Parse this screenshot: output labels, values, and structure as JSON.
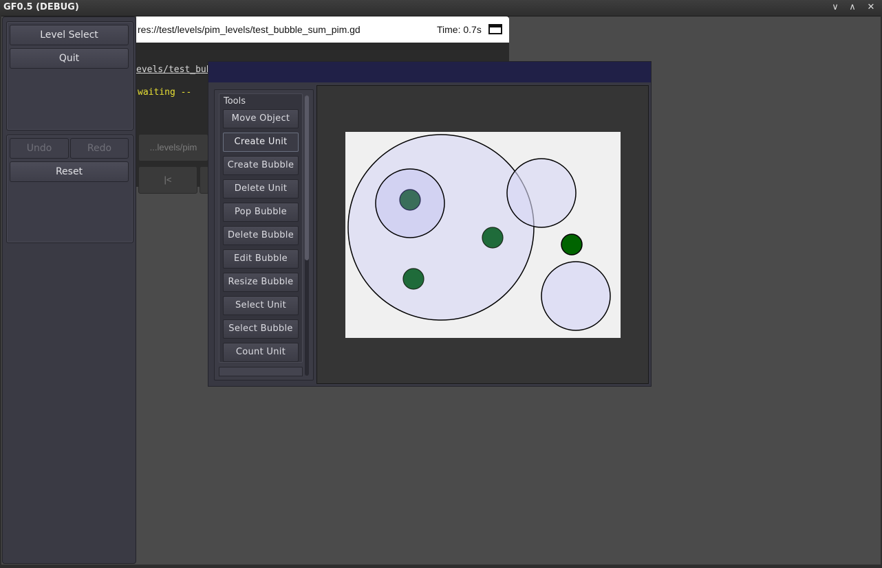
{
  "window": {
    "title": "GF0.5 (DEBUG)",
    "controls": [
      "∨",
      "∧",
      "✕"
    ]
  },
  "debug": {
    "path": "res://test/levels/pim_levels/test_bubble_sum_pim.gd",
    "time": "Time: 0.7s",
    "console_line1": "evels/test_bub",
    "console_line2": "waiting --",
    "file_button": "...levels/pim",
    "first_button": "|<"
  },
  "menu": {
    "level_select": "Level Select",
    "quit": "Quit",
    "undo": "Undo",
    "redo": "Redo",
    "reset": "Reset"
  },
  "tools": {
    "label": "Tools",
    "active": "Create Unit",
    "items": [
      "Move Object",
      "Create Unit",
      "Create Bubble",
      "Delete Unit",
      "Pop Bubble",
      "Delete Bubble",
      "Edit Bubble",
      "Resize Bubble",
      "Select Unit",
      "Select Bubble",
      "Count Unit"
    ]
  },
  "scene": {
    "background": "#f0f0f0",
    "bubble_fill": "#d7d7f5",
    "unit_color": "#1f6b3a",
    "selected_unit_color": "#006400",
    "bubbles": 4,
    "units": 4
  }
}
